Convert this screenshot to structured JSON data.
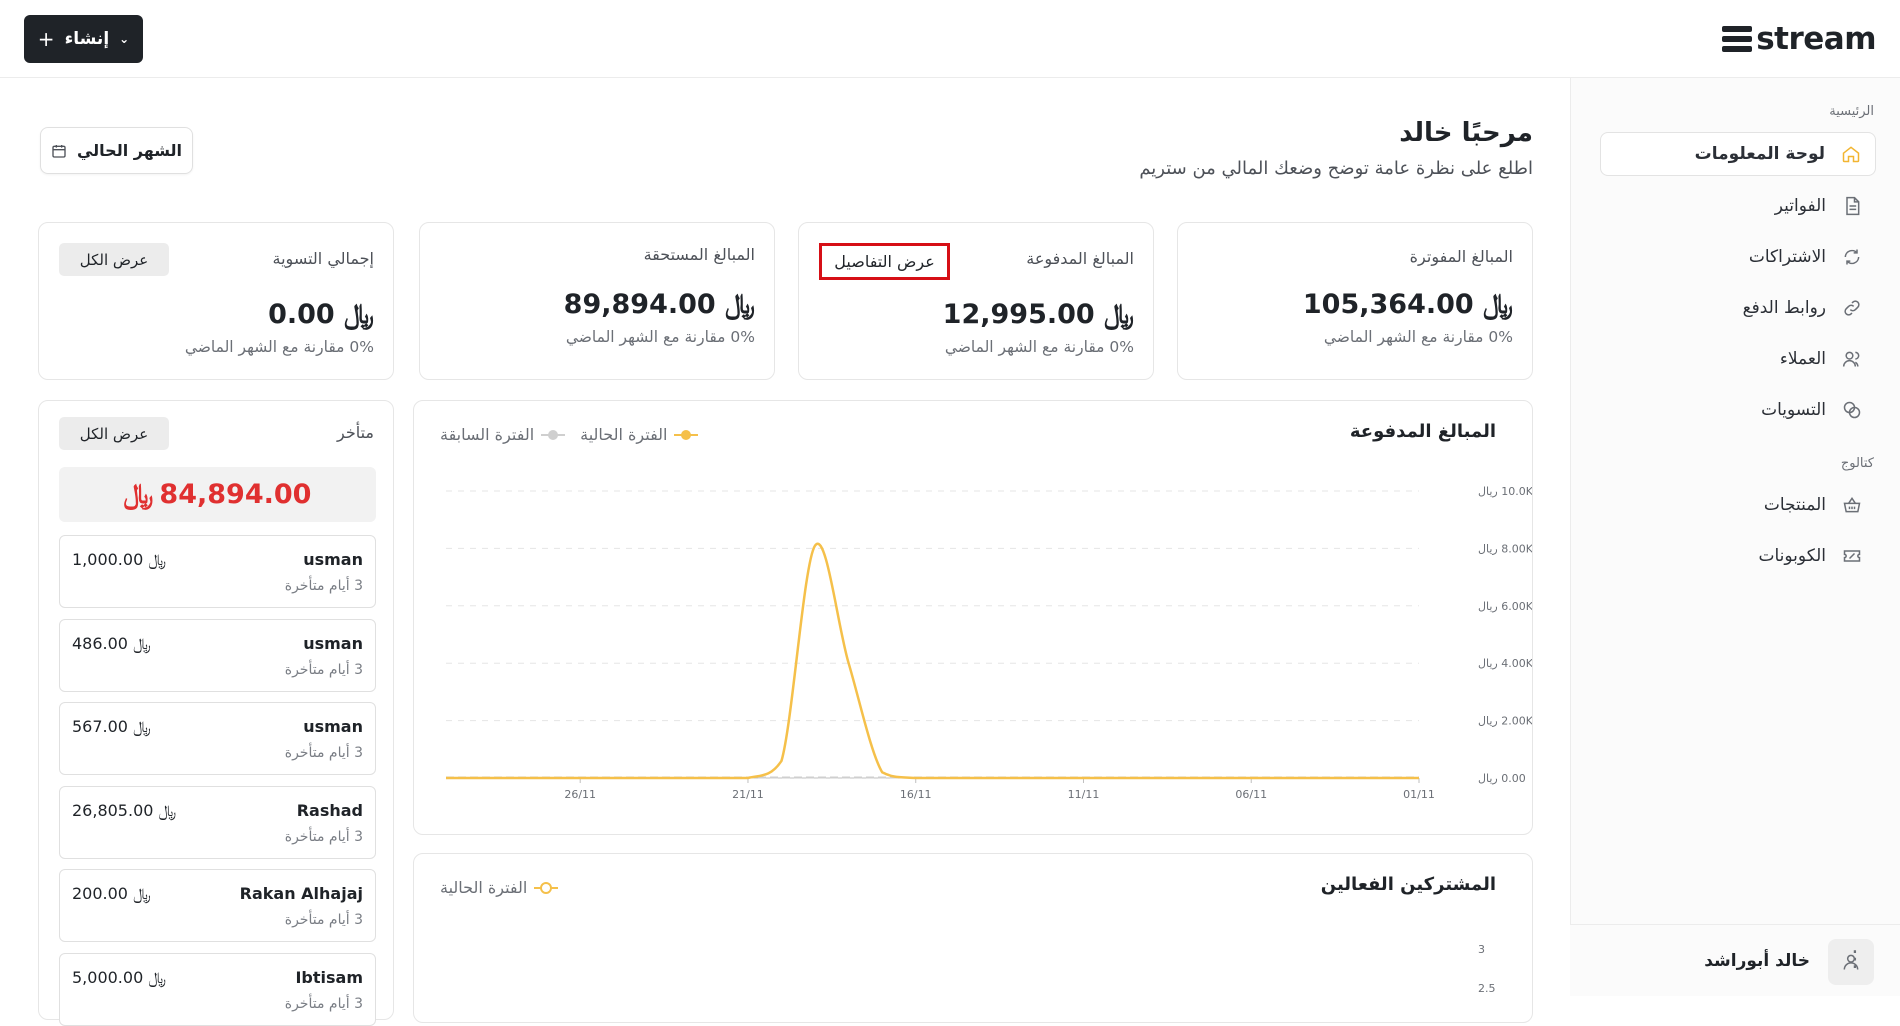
{
  "brand": {
    "name": "stream"
  },
  "header": {
    "create_label": "إنشاء"
  },
  "sidebar": {
    "section_main": "الرئيسية",
    "section_catalog": "كتالوج",
    "items": [
      {
        "label": "لوحة المعلومات",
        "icon": "home-icon",
        "active": true
      },
      {
        "label": "الفواتير",
        "icon": "file-icon"
      },
      {
        "label": "الاشتراكات",
        "icon": "refresh-icon"
      },
      {
        "label": "روابط الدفع",
        "icon": "link-icon"
      },
      {
        "label": "العملاء",
        "icon": "users-icon"
      },
      {
        "label": "التسويات",
        "icon": "coins-icon"
      }
    ],
    "catalog_items": [
      {
        "label": "المنتجات",
        "icon": "basket-icon"
      },
      {
        "label": "الكوبونات",
        "icon": "ticket-icon"
      }
    ],
    "user": {
      "name": "خالد أبوراشد"
    }
  },
  "main": {
    "greeting": "مرحبًا خالد",
    "subtitle": "اطلع على نظرة عامة توضح وضعك المالي من ستريم",
    "period_label": "الشهر الحالي"
  },
  "stats": [
    {
      "title": "المبالغ المفوترة",
      "value": "105,364.00",
      "sub": "0% مقارنة مع الشهر الماضي"
    },
    {
      "title": "المبالغ المدفوعة",
      "value": "12,995.00",
      "sub": "0% مقارنة مع الشهر الماضي",
      "action": "عرض التفاصيل"
    },
    {
      "title": "المبالغ المستحقة",
      "value": "89,894.00",
      "sub": "0% مقارنة مع الشهر الماضي"
    },
    {
      "title": "إجمالي التسوية",
      "value": "0.00",
      "sub": "0% مقارنة مع الشهر الماضي",
      "action": "عرض الكل"
    }
  ],
  "currency_symbol": "﷼",
  "overdue": {
    "title": "متأخر",
    "action": "عرض الكل",
    "total": "84,894.00",
    "items": [
      {
        "name": "usman",
        "days": "3 أيام متأخرة",
        "amount": "1,000.00"
      },
      {
        "name": "usman",
        "days": "3 أيام متأخرة",
        "amount": "486.00"
      },
      {
        "name": "usman",
        "days": "3 أيام متأخرة",
        "amount": "567.00"
      },
      {
        "name": "Rashad",
        "days": "3 أيام متأخرة",
        "amount": "26,805.00"
      },
      {
        "name": "Rakan Alhajaj",
        "days": "3 أيام متأخرة",
        "amount": "200.00"
      },
      {
        "name": "Ibtisam",
        "days": "3 أيام متأخرة",
        "amount": "5,000.00"
      }
    ]
  },
  "paid_chart": {
    "title": "المبالغ المدفوعة",
    "legend_prev": "الفترة السابقة",
    "legend_curr": "الفترة الحالية"
  },
  "subs_chart": {
    "title": "المشتركين الفعالين",
    "legend_curr": "الفترة الحالية"
  },
  "colors": {
    "accent": "#f5c04a",
    "prev": "#cfcfcf",
    "danger": "#e03030"
  },
  "chart_data": [
    {
      "type": "line",
      "title": "المبالغ المدفوعة",
      "x_ticks": [
        "26/11",
        "21/11",
        "16/11",
        "11/11",
        "06/11",
        "01/11"
      ],
      "y_ticks": [
        "10.0K ريال",
        "8.00K ريال",
        "6.00K ريال",
        "4.00K ريال",
        "2.00K ريال",
        "0.00 ريال"
      ],
      "ylim": [
        0,
        10000
      ],
      "series": [
        {
          "name": "الفترة الحالية",
          "color": "#f5c04a",
          "x": [
            "30/11",
            "28/11",
            "26/11",
            "24/11",
            "22/11",
            "21/11",
            "20/11",
            "19/11",
            "18/11",
            "17/11",
            "16/11",
            "14/11",
            "11/11",
            "06/11",
            "01/11"
          ],
          "values": [
            0,
            0,
            0,
            0,
            0,
            0,
            600,
            8100,
            4000,
            200,
            0,
            0,
            0,
            0,
            0
          ]
        },
        {
          "name": "الفترة السابقة",
          "color": "#cfcfcf",
          "x": [
            "30/11",
            "01/11"
          ],
          "values": [
            0,
            0
          ]
        }
      ]
    },
    {
      "type": "line",
      "title": "المشتركين الفعالين",
      "y_ticks": [
        "3",
        "2.5"
      ],
      "series": [
        {
          "name": "الفترة الحالية",
          "color": "#f5c04a"
        }
      ]
    }
  ]
}
